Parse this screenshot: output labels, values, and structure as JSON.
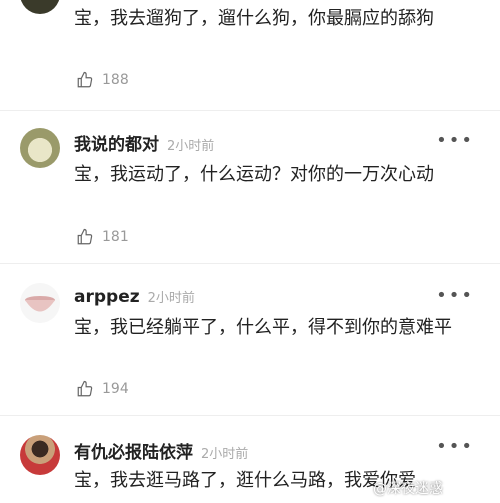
{
  "comments": [
    {
      "username": "",
      "time": "",
      "text": "宝，我去遛狗了，遛什么狗，你最膈应的舔狗",
      "likes": "188"
    },
    {
      "username": "我说的都对",
      "time": "2小时前",
      "text": "宝，我运动了，什么运动？对你的一万次心动",
      "likes": "181"
    },
    {
      "username": "arppez",
      "time": "2小时前",
      "text": "宝，我已经躺平了，什么平，得不到你的意难平",
      "likes": "194"
    },
    {
      "username": "有仇必报陆依萍",
      "time": "2小时前",
      "text": "宝，我去逛马路了，逛什么马路，我爱你爱"
    }
  ],
  "more_label": "•••",
  "watermark": "@深夜迷惑",
  "colors": {
    "text": "#222222",
    "meta": "#aaaaaa",
    "divider": "#eeeeee"
  }
}
